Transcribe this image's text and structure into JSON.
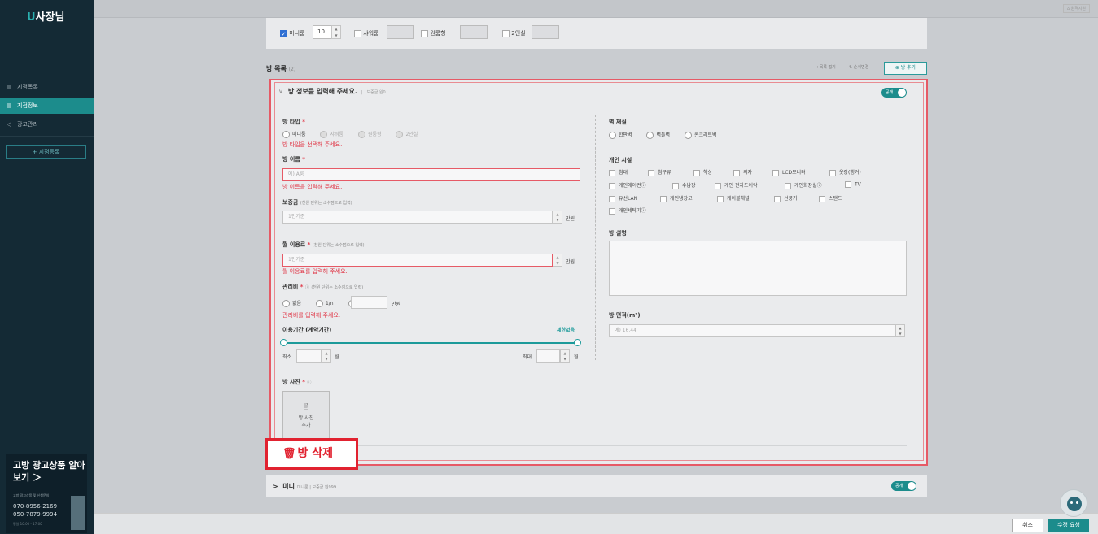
{
  "sidebar": {
    "logo_u": "U",
    "logo_text": "사장님",
    "items": [
      {
        "icon": "▤",
        "label": "지점목록"
      },
      {
        "icon": "▤",
        "label": "지점정보"
      },
      {
        "icon": "◁",
        "label": "광고관리"
      }
    ],
    "register": "+ 지점등록",
    "ad": {
      "title": "고방 광고상품 알아보기 ＞",
      "subtitle": "고방 광고상품 및 신청문의",
      "phone1": "070-8956-2169",
      "phone2": "050-7879-9994",
      "hours": "평일 10:00 - 17:00"
    }
  },
  "topbar": {
    "link": "⌂ 원격지원"
  },
  "room_types": {
    "mini": {
      "label": "미니룸",
      "value": "10"
    },
    "shower": {
      "label": "샤워룸"
    },
    "oneroom": {
      "label": "원룸형"
    },
    "double": {
      "label": "2인실"
    }
  },
  "room_list": {
    "title": "방 목록",
    "count": "(2)",
    "fold": "∷ 목록 접기",
    "reorder": "⇅ 순서변경",
    "add": "⊕ 방 추가"
  },
  "room_form": {
    "header": "방 정보를 입력해 주세요.",
    "header_sub": "보증금 원0",
    "toggle": "공개",
    "room_type": {
      "label": "방 타입",
      "required": "*",
      "options": [
        "미니룸",
        "샤워룸",
        "원룸형",
        "2인실"
      ],
      "error": "방 타입을 선택해 주세요."
    },
    "room_name": {
      "label": "방 이름",
      "required": "*",
      "placeholder": "예) A룸",
      "error": "방 이름을 입력해 주세요."
    },
    "deposit": {
      "label": "보증금",
      "hint": "(천원 단위는 소수점으로 입력)",
      "placeholder": "1인기준",
      "unit": "만원"
    },
    "monthly": {
      "label": "월 이용료",
      "required": "*",
      "hint": "(천원 단위는 소수점으로 입력)",
      "placeholder": "1인기준",
      "unit": "만원",
      "error": "월 이용료를 입력해 주세요."
    },
    "mgmt": {
      "label": "관리비",
      "required": "*",
      "info": "ⓘ",
      "hint": "(천원 단위는 소수점으로 입력)",
      "options": [
        "없음",
        "1/n"
      ],
      "unit": "만원",
      "error": "관리비를 입력해 주세요."
    },
    "period": {
      "label": "이용기간 (계약기간)",
      "status": "제한없음",
      "min_label": "최소",
      "max_label": "최대",
      "unit": "월"
    },
    "photo": {
      "label": "방 사진",
      "required": "*",
      "info": "ⓘ",
      "icon": "🖹",
      "button_line1": "방 사진",
      "button_line2": "추가"
    },
    "wall": {
      "label": "벽 재질",
      "options": [
        "합판벽",
        "벽돌벽",
        "콘크리트벽"
      ]
    },
    "facilities": {
      "label": "개인 시설",
      "rows": [
        [
          "침대",
          "침구류",
          "책상",
          "의자",
          "LCD모니터",
          "옷장(행거)"
        ],
        [
          "개인에어컨ⓘ",
          "수납장",
          "개인 전자도어락",
          "개인화장실ⓘ",
          "TV"
        ],
        [
          "유선LAN",
          "개인냉장고",
          "케이블채널",
          "선풍기",
          "스탠드"
        ],
        [
          "개인세탁기ⓘ"
        ]
      ]
    },
    "description": {
      "label": "방 설명"
    },
    "area": {
      "label": "방 면적(m²)",
      "placeholder": "예) 16.44"
    }
  },
  "delete": {
    "icon": "🗑",
    "label": "방 삭제"
  },
  "room2": {
    "chevron": ">",
    "name": "미니",
    "sub": "미니룸 | 보증금 원999",
    "toggle": "공개"
  },
  "bottom": {
    "cancel": "취소",
    "save": "수정 요청"
  }
}
